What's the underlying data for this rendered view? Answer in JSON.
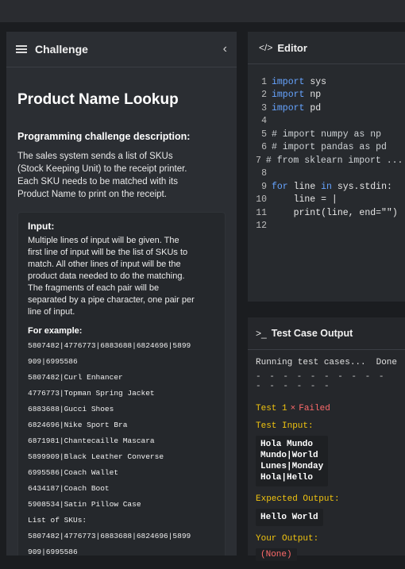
{
  "challenge_pane": {
    "header_title": "Challenge",
    "collapse_glyph": "‹",
    "title": "Product Name Lookup",
    "desc_title": "Programming challenge description:",
    "desc_lines": [
      "The sales system sends a list of SKUs",
      "(Stock Keeping Unit) to the receipt printer.",
      "Each SKU needs to be matched with its",
      "Product Name to print on the receipt."
    ],
    "input_title": "Input:",
    "input_desc_lines": [
      "Multiple lines of input will be given. The",
      "first line of input will be the list of SKUs to",
      "match. All other lines of input will be the",
      "product data needed to do the matching.",
      "The fragments of each pair will be",
      "separated by a pipe character, one pair per",
      "line of input."
    ],
    "example_title": "For example:",
    "example_lines": [
      "5807482|4776773|6883688|6824696|5899",
      "909|6995586",
      "5807482|Curl Enhancer",
      "4776773|Topman Spring Jacket",
      "6883688|Gucci Shoes",
      "6824696|Nike Sport Bra",
      "6871981|Chantecaille Mascara",
      "5899909|Black Leather Converse",
      "6995586|Coach Wallet",
      "6434187|Coach Boot",
      "5908534|Satin Pillow Case",
      "List of SKUs:",
      "5807482|4776773|6883688|6824696|5899",
      "909|6995586"
    ]
  },
  "editor": {
    "header_icon": "</>",
    "header_title": "Editor",
    "lines": [
      {
        "n": "1",
        "segments": [
          {
            "text": "import",
            "type": "kw"
          },
          {
            "text": " sys",
            "type": "normal"
          }
        ]
      },
      {
        "n": "2",
        "segments": [
          {
            "text": "import",
            "type": "kw"
          },
          {
            "text": " np",
            "type": "normal"
          }
        ]
      },
      {
        "n": "3",
        "segments": [
          {
            "text": "import",
            "type": "kw"
          },
          {
            "text": " pd",
            "type": "normal"
          }
        ]
      },
      {
        "n": "4",
        "segments": []
      },
      {
        "n": "5",
        "segments": [
          {
            "text": "# import numpy as np",
            "type": "cm"
          }
        ]
      },
      {
        "n": "6",
        "segments": [
          {
            "text": "# import pandas as pd",
            "type": "cm"
          }
        ]
      },
      {
        "n": "7",
        "segments": [
          {
            "text": "# from sklearn import ...",
            "type": "cm"
          }
        ]
      },
      {
        "n": "8",
        "segments": []
      },
      {
        "n": "9",
        "segments": [
          {
            "text": "for",
            "type": "kw"
          },
          {
            "text": " line ",
            "type": "normal"
          },
          {
            "text": "in",
            "type": "kw"
          },
          {
            "text": " sys.stdin:",
            "type": "normal"
          }
        ]
      },
      {
        "n": "10",
        "segments": [
          {
            "text": "    line = |",
            "type": "normal"
          }
        ]
      },
      {
        "n": "11",
        "segments": [
          {
            "text": "    print(line, end=\"\")",
            "type": "normal"
          }
        ]
      },
      {
        "n": "12",
        "segments": []
      }
    ]
  },
  "tests": {
    "header_icon": ">_",
    "header_title": "Test Case Output",
    "running": "Running test cases...",
    "done": "Done",
    "dashes": "- - - - - - - - - - - - - - - -",
    "test_label": "Test 1",
    "x_glyph": "×",
    "failed": "Failed",
    "input_title": "Test Input:",
    "input_lines": [
      "Hola Mundo",
      "Mundo|World",
      "Lunes|Monday",
      "Hola|Hello"
    ],
    "expected_title": "Expected Output:",
    "expected": "Hello World",
    "your_output_title": "Your Output:",
    "your_output": "(None)"
  },
  "colors": {
    "keyword": "#66a4ff",
    "failed": "#ff6b6b",
    "label_yellow": "#f1c40f"
  }
}
